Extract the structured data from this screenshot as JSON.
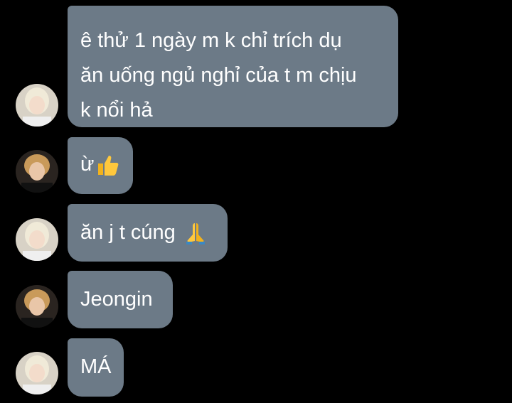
{
  "messages": [
    {
      "sender": "avatar-a",
      "lines": [
        "ê thử 1 ngày m k chỉ trích dụ",
        "ăn uống ngủ nghỉ của t m chịu",
        "k nổi hả"
      ],
      "emoji": ""
    },
    {
      "sender": "avatar-b",
      "lines": [
        "ừ"
      ],
      "emoji": "thumbs-up-icon"
    },
    {
      "sender": "avatar-a",
      "lines": [
        "ăn j t cúng "
      ],
      "emoji": "folded-hands-icon"
    },
    {
      "sender": "avatar-b",
      "lines": [
        "Jeongin"
      ],
      "emoji": ""
    },
    {
      "sender": "avatar-a",
      "lines": [
        "MÁ"
      ],
      "emoji": ""
    }
  ],
  "colors": {
    "background": "#000000",
    "bubble": "#6c7a87",
    "text": "#ffffff"
  }
}
